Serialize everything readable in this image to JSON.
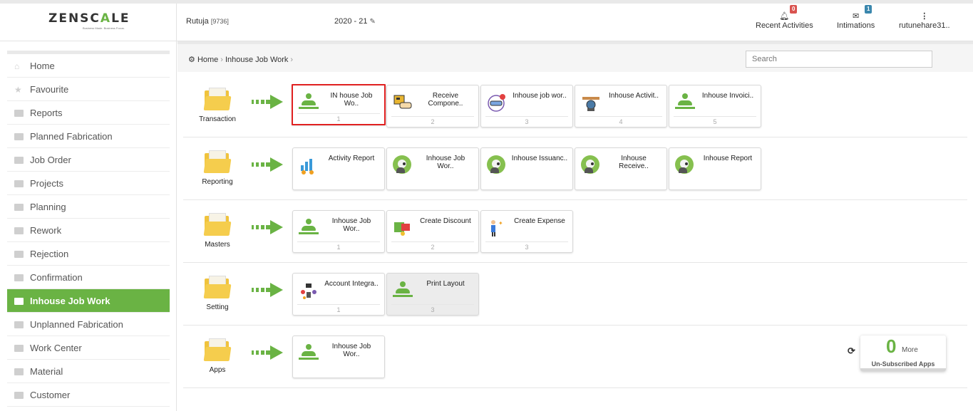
{
  "brand": {
    "logo_left": "ZENSC",
    "logo_accent": "A",
    "logo_right": "LE",
    "tagline": "Business Made. Business Focus."
  },
  "header": {
    "user": "Rutuja",
    "user_id": "[9736]",
    "fiscal_year": "2020 - 21",
    "recent_activities": {
      "label": "Recent Activities",
      "count": "0"
    },
    "intimations": {
      "label": "Intimations",
      "count": "1"
    },
    "account": {
      "label": "rutunehare31.."
    }
  },
  "sidebar": {
    "items": [
      {
        "label": "Home",
        "icon": "home-icon"
      },
      {
        "label": "Favourite",
        "icon": "star-icon"
      },
      {
        "label": "Reports",
        "icon": "file-icon"
      },
      {
        "label": "Planned Fabrication",
        "icon": "folder-icon"
      },
      {
        "label": "Job Order",
        "icon": "folder-icon"
      },
      {
        "label": "Projects",
        "icon": "folder-icon"
      },
      {
        "label": "Planning",
        "icon": "folder-icon"
      },
      {
        "label": "Rework",
        "icon": "folder-icon"
      },
      {
        "label": "Rejection",
        "icon": "folder-icon"
      },
      {
        "label": "Confirmation",
        "icon": "folder-icon"
      },
      {
        "label": "Inhouse Job Work",
        "icon": "folder-icon",
        "active": true
      },
      {
        "label": "Unplanned Fabrication",
        "icon": "folder-icon"
      },
      {
        "label": "Work Center",
        "icon": "folder-icon"
      },
      {
        "label": "Material",
        "icon": "folder-icon"
      },
      {
        "label": "Customer",
        "icon": "folder-icon"
      }
    ]
  },
  "breadcrumb": {
    "home": "Home",
    "current": "Inhouse Job Work"
  },
  "search": {
    "placeholder": "Search"
  },
  "groups": [
    {
      "label": "Transaction",
      "cards": [
        {
          "title1": "IN house Job",
          "title2": "Wo..",
          "num": "1",
          "icon": "person-icon"
        },
        {
          "title1": "Receive",
          "title2": "Compone..",
          "num": "2",
          "icon": "receive-icon"
        },
        {
          "title1": "Inhouse job wor..",
          "title2": "",
          "num": "3",
          "icon": "issue-icon"
        },
        {
          "title1": "Inhouse Activit..",
          "title2": "",
          "num": "4",
          "icon": "handshake-icon"
        },
        {
          "title1": "Inhouse Invoici..",
          "title2": "",
          "num": "5",
          "icon": "person-icon"
        }
      ]
    },
    {
      "label": "Reporting",
      "cards": [
        {
          "title1": "Activity Report",
          "title2": "",
          "icon": "chart-icon"
        },
        {
          "title1": "Inhouse Job",
          "title2": "Wor..",
          "icon": "avatar-icon"
        },
        {
          "title1": "Inhouse Issuanc..",
          "title2": "",
          "icon": "avatar-icon"
        },
        {
          "title1": "Inhouse",
          "title2": "Receive..",
          "icon": "avatar-icon"
        },
        {
          "title1": "Inhouse Report",
          "title2": "",
          "icon": "avatar-icon"
        }
      ]
    },
    {
      "label": "Masters",
      "cards": [
        {
          "title1": "Inhouse Job",
          "title2": "Wor..",
          "num": "1",
          "icon": "person-icon"
        },
        {
          "title1": "Create Discount",
          "title2": "",
          "num": "2",
          "icon": "discount-icon"
        },
        {
          "title1": "Create Expense",
          "title2": "",
          "num": "3",
          "icon": "expense-icon"
        }
      ]
    },
    {
      "label": "Setting",
      "cards": [
        {
          "title1": "Account Integra..",
          "title2": "",
          "num": "1",
          "icon": "integration-icon"
        },
        {
          "title1": "Print Layout",
          "title2": "",
          "num": "3",
          "icon": "person-icon"
        }
      ]
    },
    {
      "label": "Apps",
      "cards": [
        {
          "title1": "Inhouse Job",
          "title2": "Wor..",
          "icon": "person-icon"
        }
      ]
    }
  ],
  "unsubscribed": {
    "count": "0",
    "more": "More",
    "label": "Un-Subscribed Apps"
  },
  "colors": {
    "accent": "#6ab344",
    "folder": "#f5cd4d",
    "selected_border": "#e02020"
  }
}
